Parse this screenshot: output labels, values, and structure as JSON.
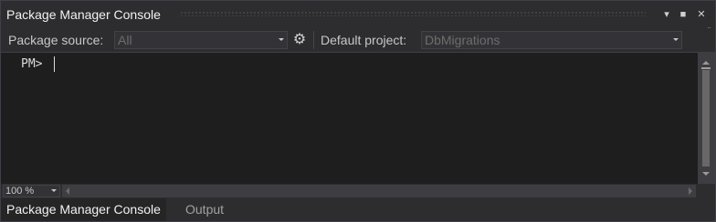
{
  "window": {
    "title": "Package Manager Console"
  },
  "title_buttons": {
    "dropdown": "▾",
    "maximize": "■",
    "close": "✕"
  },
  "toolbar": {
    "package_source_label": "Package source:",
    "package_source_value": "All",
    "settings_icon": "⚙",
    "default_project_label": "Default project:",
    "default_project_value": "DbMigrations",
    "overflow_icon": "¨"
  },
  "console": {
    "prompt": "PM>"
  },
  "zoom": {
    "value": "100 %"
  },
  "tabs": [
    {
      "label": "Package Manager Console",
      "active": true
    },
    {
      "label": "Output",
      "active": false
    }
  ],
  "colors": {
    "background": "#2d2d30",
    "console_background": "#1e1e1e",
    "text": "#f1f1f1",
    "disabled_text": "#6d6d6d",
    "scrollbar_thumb": "#686868"
  }
}
